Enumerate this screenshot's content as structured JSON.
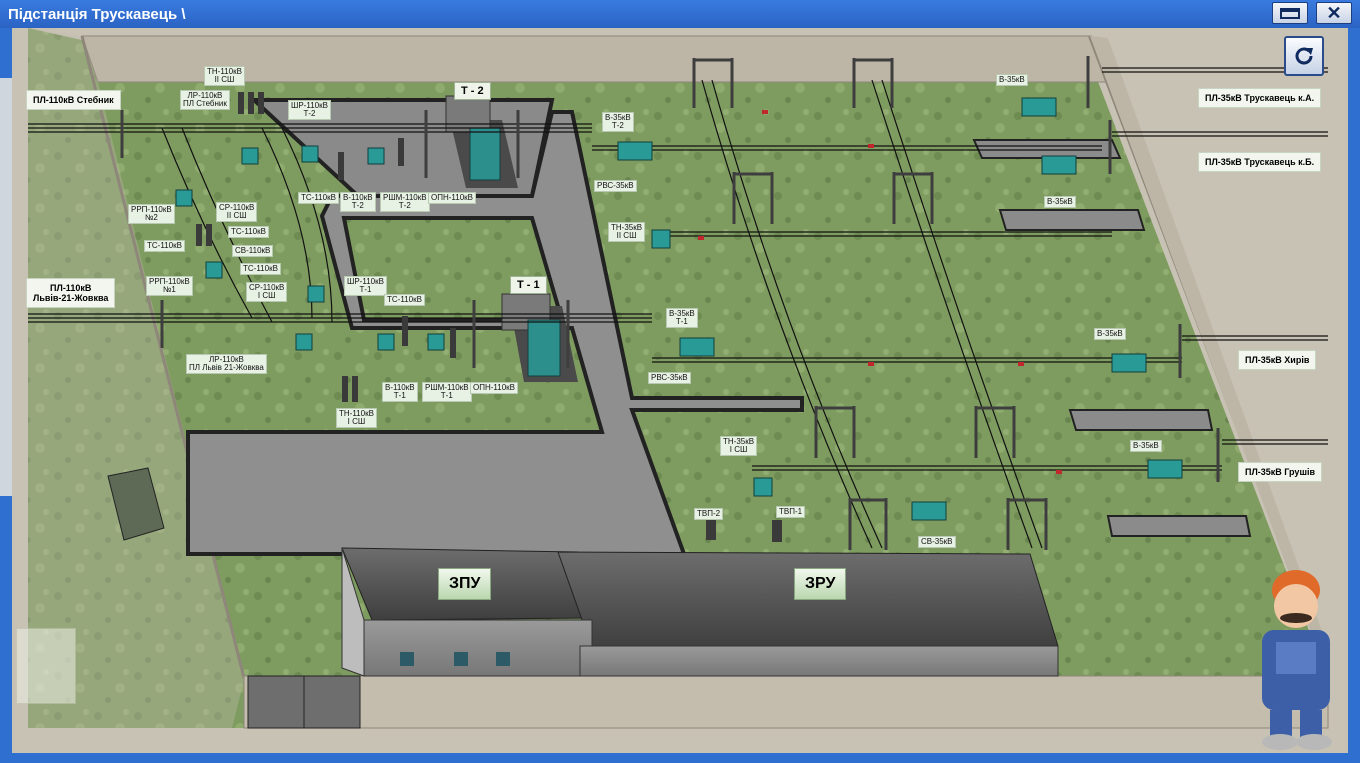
{
  "window": {
    "title": "Підстанція Трускавець \\",
    "maximize_icon": "maximize-icon",
    "close_label": "✕"
  },
  "colors": {
    "titlebar": "#2f6fd0",
    "grass": "#7d9a5f",
    "road": "#8e8e8e",
    "equipment": "#2a9a96",
    "label_bg": "#e8f2e4"
  },
  "buildings": {
    "zpu": "ЗПУ",
    "zru": "ЗРУ"
  },
  "transformers": {
    "t2": "Т - 2",
    "t1": "Т - 1"
  },
  "feeders": {
    "stebnyk": "ПЛ-110кВ Стебник",
    "lviv": "ПЛ-110кВ\nЛьвів-21-Жовква",
    "tr_a": "ПЛ-35кВ Трускавець к.А.",
    "tr_b": "ПЛ-35кВ Трускавець к.Б.",
    "khyriv": "ПЛ-35кВ Хирів",
    "grushiv": "ПЛ-35кВ Грушів"
  },
  "labels": {
    "tn110_2": "ТН-110кВ\nII СШ",
    "lr110_st": "ЛР-110кВ\nПЛ Стебник",
    "shr110_t2": "ШР-110кВ\nТ-2",
    "rrp110_2": "РРП-110кВ\n№2",
    "sr110_2": "СР-110кВ\nII СШ",
    "ts110_a": "ТС-110кВ",
    "ts110_b": "ТС-110кВ",
    "ts110_c": "ТС-110кВ",
    "ts110_d": "ТС-110кВ",
    "ts110_e": "ТС-110кВ",
    "sv110": "СВ-110кВ",
    "v110_t2": "В-110кВ\nТ-2",
    "rshm110_t2": "РШМ-110кВ\nТ-2",
    "opn110_t2": "ОПН-110кВ",
    "rrp110_1": "РРП-110кВ\n№1",
    "sr110_1": "СР-110кВ\nI СШ",
    "shr110_t1": "ШР-110кВ\nТ-1",
    "lr110_lv": "ЛР-110кВ\nПЛ Львів 21-Жовква",
    "v110_t1": "В-110кВ\nТ-1",
    "rshm110_t1": "РШМ-110кВ\nТ-1",
    "opn110_t1": "ОПН-110кВ",
    "tn110_1": "ТН-110кВ\nI СШ",
    "v35_t2": "В-35кВ\nТ-2",
    "rvs35_a": "РВС-35кВ",
    "tn35_2": "ТН-35кВ\nII СШ",
    "v35_t1": "В-35кВ\nТ-1",
    "rvs35_b": "РВС-35кВ",
    "v35_a": "В-35кВ",
    "v35_b": "В-35кВ",
    "v35_c": "В-35кВ",
    "v35_d": "В-35кВ",
    "tn35_1": "ТН-35кВ\nI СШ",
    "tvp2": "ТВП-2",
    "tvp1": "ТВП-1",
    "sv35": "СВ-35кВ"
  }
}
